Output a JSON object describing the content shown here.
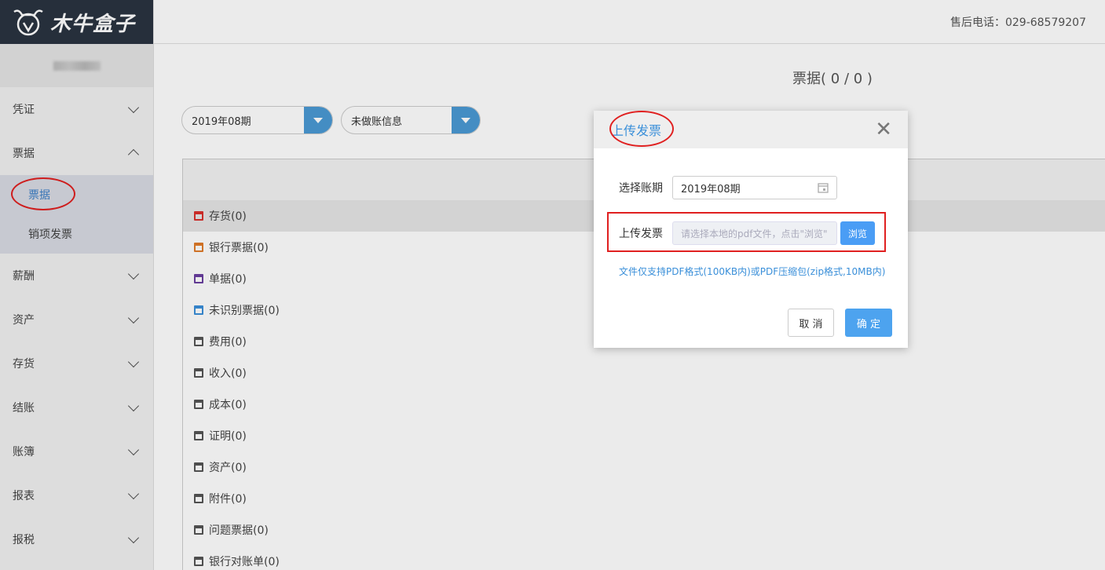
{
  "brand": {
    "name": "木牛盒子",
    "icon": "bull-logo-icon"
  },
  "header": {
    "hotline": "售后电话：029-68579207"
  },
  "sidebar": {
    "items": [
      {
        "label": "凭证",
        "state": "collapsed"
      },
      {
        "label": "票据",
        "state": "expanded"
      },
      {
        "label": "薪酬",
        "state": "collapsed"
      },
      {
        "label": "资产",
        "state": "collapsed"
      },
      {
        "label": "存货",
        "state": "collapsed"
      },
      {
        "label": "结账",
        "state": "collapsed"
      },
      {
        "label": "账簿",
        "state": "collapsed"
      },
      {
        "label": "报表",
        "state": "collapsed"
      },
      {
        "label": "报税",
        "state": "collapsed"
      }
    ],
    "sub_items": [
      {
        "label": "票据",
        "active": true
      },
      {
        "label": "销项发票",
        "active": false
      }
    ]
  },
  "main": {
    "title": "票据( 0 / 0 )",
    "period_select": "2019年08期",
    "status_select": "未做账信息",
    "categories": [
      {
        "label": "存货(0)",
        "color": "#d9302c"
      },
      {
        "label": "银行票据(0)",
        "color": "#e07b2a"
      },
      {
        "label": "单据(0)",
        "color": "#6a3fa0"
      },
      {
        "label": "未识别票据(0)",
        "color": "#3a8fd9"
      },
      {
        "label": "费用(0)",
        "color": "#555555"
      },
      {
        "label": "收入(0)",
        "color": "#555555"
      },
      {
        "label": "成本(0)",
        "color": "#555555"
      },
      {
        "label": "证明(0)",
        "color": "#555555"
      },
      {
        "label": "资产(0)",
        "color": "#555555"
      },
      {
        "label": "附件(0)",
        "color": "#555555"
      },
      {
        "label": "问题票据(0)",
        "color": "#555555"
      },
      {
        "label": "银行对账单(0)",
        "color": "#555555"
      }
    ]
  },
  "dialog": {
    "title": "上传发票",
    "close_icon": "close-icon",
    "period_label": "选择账期",
    "period_value": "2019年08期",
    "upload_label": "上传发票",
    "upload_placeholder": "请选择本地的pdf文件，点击\"浏览\"",
    "browse_label": "浏览",
    "hint": "文件仅支持PDF格式(100KB内)或PDF压缩包(zip格式,10MB内)",
    "cancel_label": "取 消",
    "ok_label": "确 定"
  }
}
